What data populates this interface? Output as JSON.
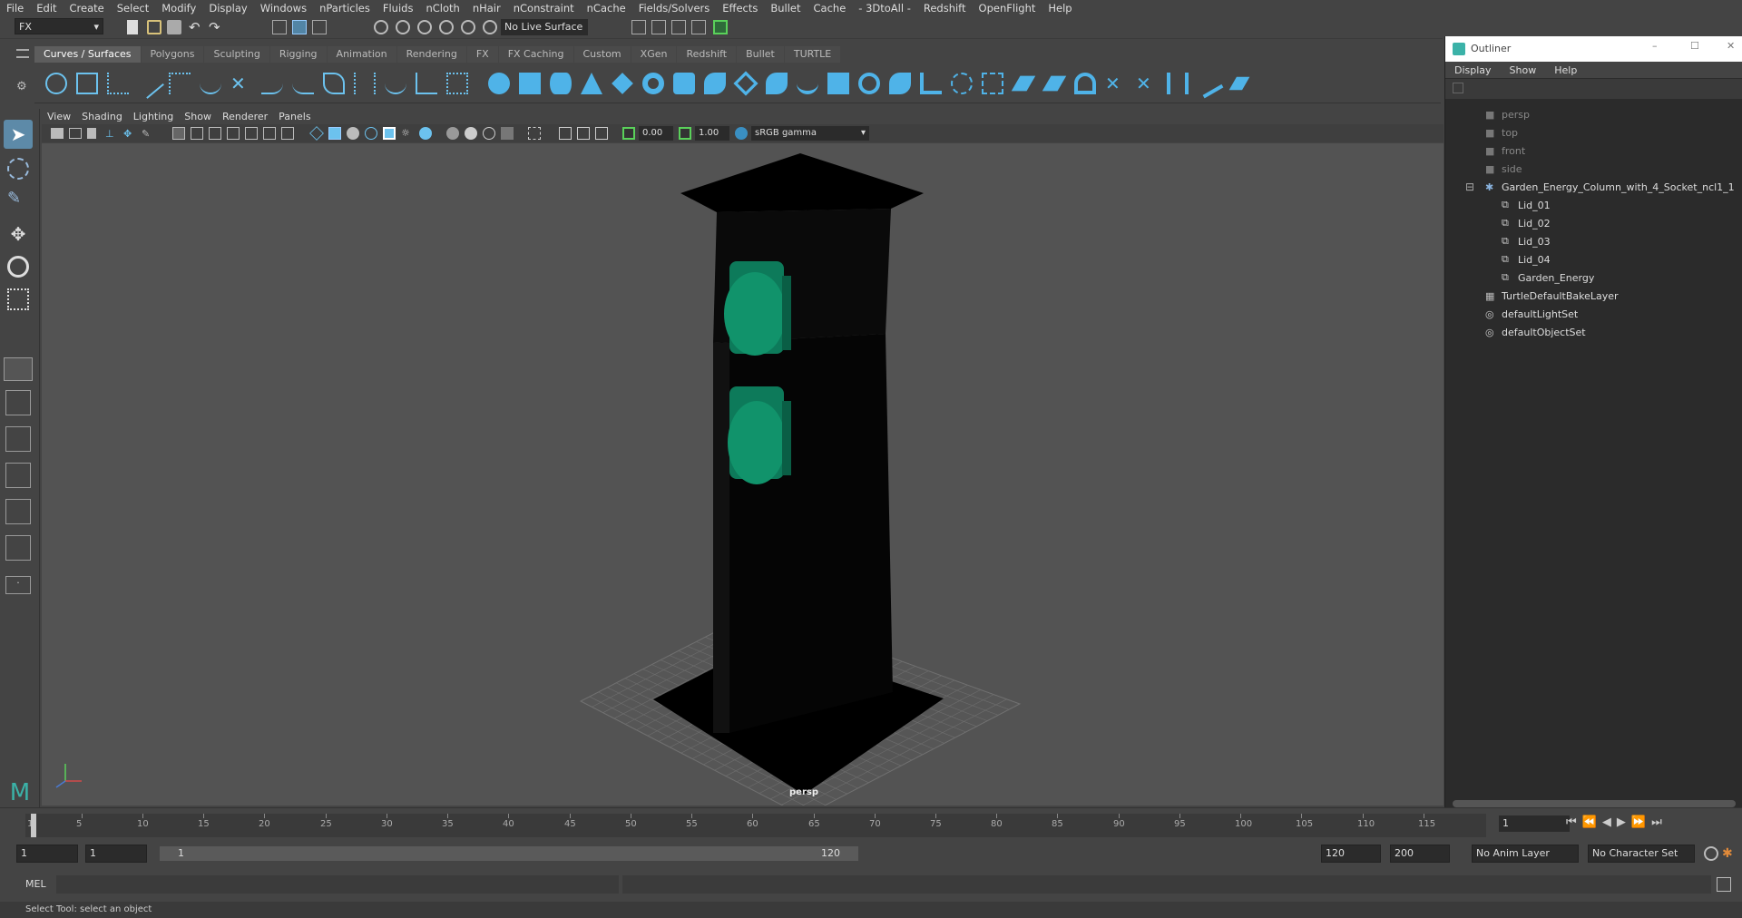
{
  "menu": {
    "items": [
      "File",
      "Edit",
      "Create",
      "Select",
      "Modify",
      "Display",
      "Windows",
      "nParticles",
      "Fluids",
      "nCloth",
      "nHair",
      "nConstraint",
      "nCache",
      "Fields/Solvers",
      "Effects",
      "Bullet",
      "Cache",
      "- 3DtoAll -",
      "Redshift",
      "OpenFlight",
      "Help"
    ]
  },
  "toolbar": {
    "menuset": "FX",
    "live_surface": "No Live Surface"
  },
  "shelf": {
    "tabs": [
      "Curves / Surfaces",
      "Polygons",
      "Sculpting",
      "Rigging",
      "Animation",
      "Rendering",
      "FX",
      "FX Caching",
      "Custom",
      "XGen",
      "Redshift",
      "Bullet",
      "TURTLE"
    ],
    "active_tab": "Curves / Surfaces"
  },
  "viewport": {
    "menu": [
      "View",
      "Shading",
      "Lighting",
      "Show",
      "Renderer",
      "Panels"
    ],
    "exposure": "0.00",
    "gamma": "1.00",
    "colorspace": "sRGB gamma",
    "camera_label": "persp"
  },
  "outliner": {
    "title": "Outliner",
    "menu": [
      "Display",
      "Show",
      "Help"
    ],
    "items": [
      {
        "label": "persp",
        "type": "camera"
      },
      {
        "label": "top",
        "type": "camera"
      },
      {
        "label": "front",
        "type": "camera"
      },
      {
        "label": "side",
        "type": "camera"
      },
      {
        "label": "Garden_Energy_Column_with_4_Socket_ncl1_1",
        "type": "group"
      },
      {
        "label": "Lid_01",
        "type": "mesh"
      },
      {
        "label": "Lid_02",
        "type": "mesh"
      },
      {
        "label": "Lid_03",
        "type": "mesh"
      },
      {
        "label": "Lid_04",
        "type": "mesh"
      },
      {
        "label": "Garden_Energy",
        "type": "mesh"
      },
      {
        "label": "TurtleDefaultBakeLayer",
        "type": "node"
      },
      {
        "label": "defaultLightSet",
        "type": "set"
      },
      {
        "label": "defaultObjectSet",
        "type": "set"
      }
    ]
  },
  "timeline": {
    "ticks": [
      "1",
      "5",
      "10",
      "15",
      "20",
      "25",
      "30",
      "35",
      "40",
      "45",
      "50",
      "55",
      "60",
      "65",
      "70",
      "75",
      "80",
      "85",
      "90",
      "95",
      "100",
      "105",
      "110",
      "115"
    ],
    "current_frame": "1"
  },
  "range": {
    "start": "1",
    "playback_start": "1",
    "slider_start": "1",
    "slider_end": "120",
    "playback_end": "120",
    "end": "200",
    "anim_layer": "No Anim Layer",
    "character_set": "No Character Set"
  },
  "cmd": {
    "label": "MEL"
  },
  "status": {
    "text": "Select Tool: select an object"
  }
}
